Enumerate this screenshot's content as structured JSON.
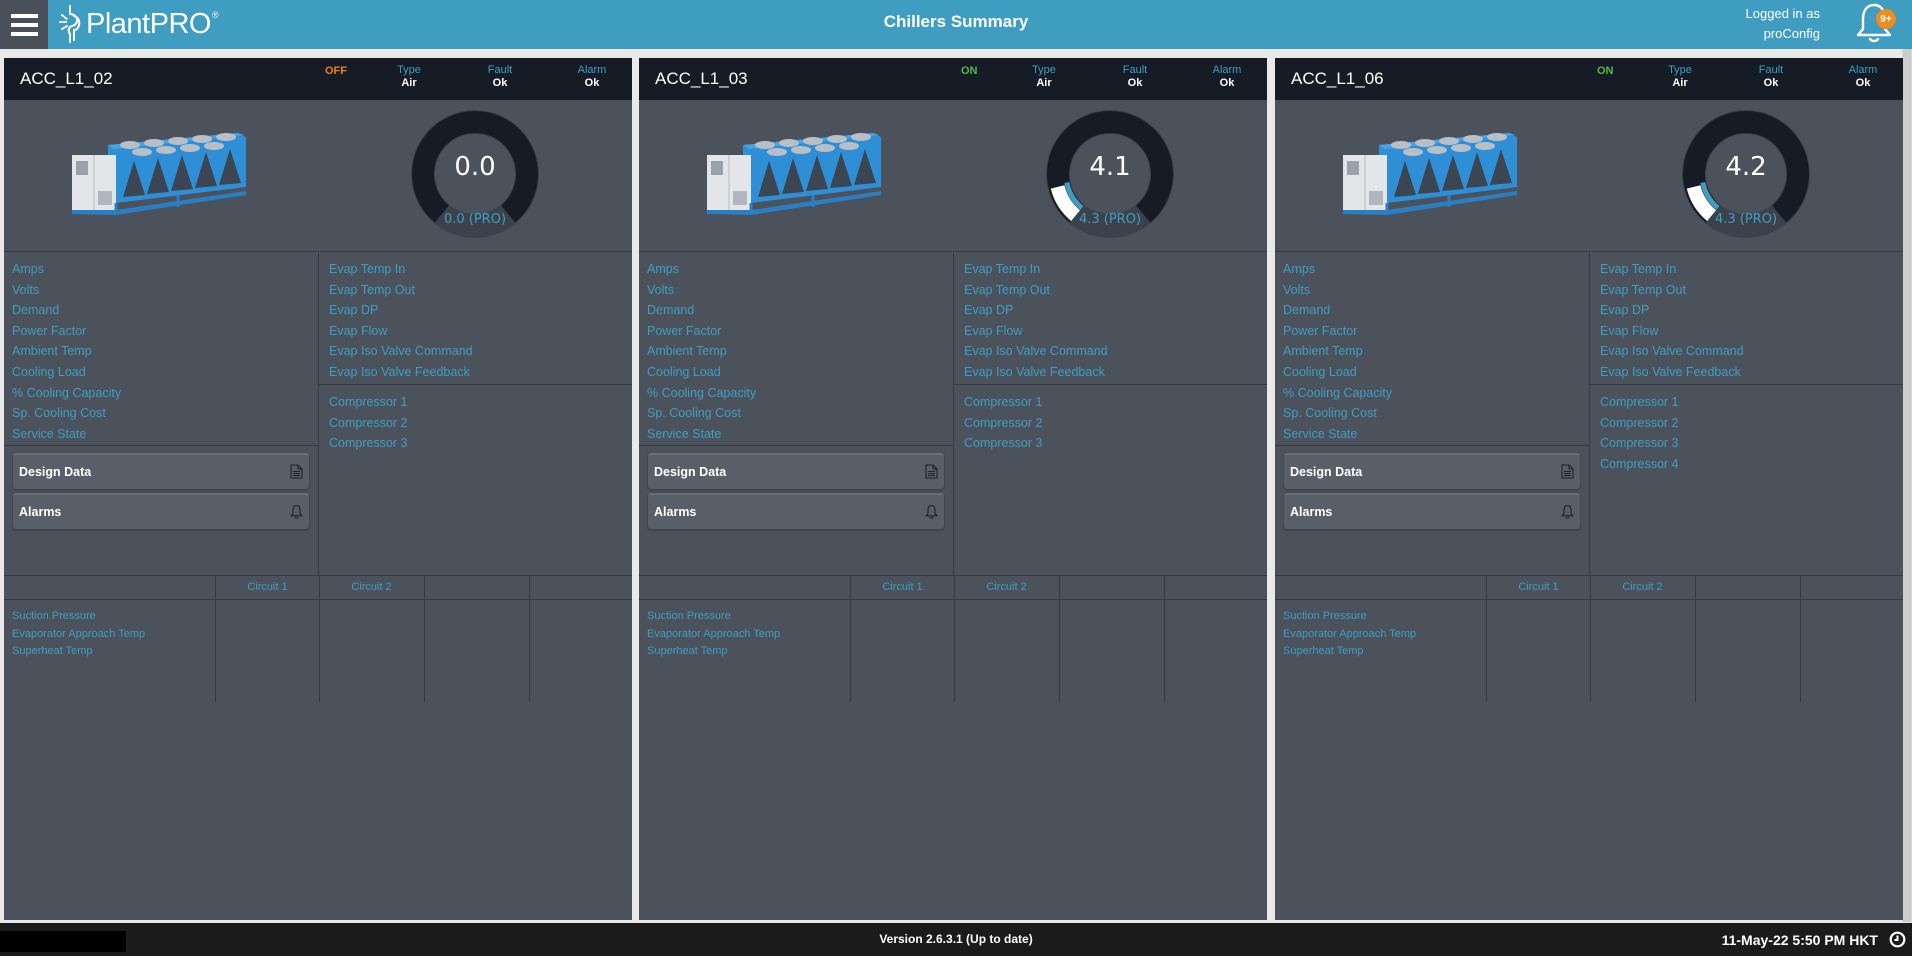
{
  "header": {
    "brand": "PlantPRO",
    "brand_mark": "®",
    "title": "Chillers Summary",
    "login_line1": "Logged in as",
    "login_line2": "proConfig",
    "notification_badge": "9+"
  },
  "colors": {
    "accent": "#3f9dc2",
    "status_off": "#f07f1c",
    "status_on": "#55b947",
    "card_bg": "#4b525b",
    "card_header_bg": "#161c25",
    "badge": "#f08c1e"
  },
  "labels": {
    "type": "Type",
    "fault": "Fault",
    "alarm": "Alarm",
    "design_data": "Design Data",
    "alarms": "Alarms"
  },
  "left_metrics": [
    "Amps",
    "Volts",
    "Demand",
    "Power Factor",
    "Ambient Temp",
    "Cooling Load",
    "% Cooling Capacity",
    "Sp. Cooling Cost",
    "Service State"
  ],
  "evap_metrics": [
    "Evap Temp In",
    "Evap Temp Out",
    "Evap DP",
    "Evap Flow",
    "Evap Iso Valve Command",
    "Evap Iso Valve Feedback"
  ],
  "circuit_headers": [
    "Circuit 1",
    "Circuit 2",
    "",
    ""
  ],
  "circuit_rows": [
    "Suction Pressure",
    "Evaporator Approach Temp",
    "Superheat Temp"
  ],
  "chillers": [
    {
      "name": "ACC_L1_02",
      "state": "OFF",
      "type": "Air",
      "fault": "Ok",
      "alarm": "Ok",
      "gauge_value": "0.0",
      "gauge_sub": "0.0 (PRO)",
      "gauge_fraction": 0.0,
      "gauge_pro_fraction": 0.0,
      "compressors": [
        "Compressor 1",
        "Compressor 2",
        "Compressor 3"
      ]
    },
    {
      "name": "ACC_L1_03",
      "state": "ON",
      "type": "Air",
      "fault": "Ok",
      "alarm": "Ok",
      "gauge_value": "4.1",
      "gauge_sub": "4.3 (PRO)",
      "gauge_fraction": 0.13,
      "gauge_pro_fraction": 0.14,
      "compressors": [
        "Compressor 1",
        "Compressor 2",
        "Compressor 3"
      ]
    },
    {
      "name": "ACC_L1_06",
      "state": "ON",
      "type": "Air",
      "fault": "Ok",
      "alarm": "Ok",
      "gauge_value": "4.2",
      "gauge_sub": "4.3 (PRO)",
      "gauge_fraction": 0.13,
      "gauge_pro_fraction": 0.14,
      "compressors": [
        "Compressor 1",
        "Compressor 2",
        "Compressor 3",
        "Compressor 4"
      ]
    }
  ],
  "footer": {
    "version": "Version 2.6.3.1 (Up to date)",
    "datetime": "11-May-22 5:50 PM HKT"
  }
}
